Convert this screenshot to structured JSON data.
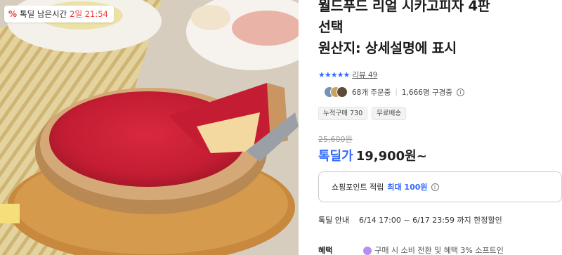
{
  "deal_timer": {
    "icon": "percent-icon",
    "label": "톡딜 남은시간",
    "time": "2일 21:54",
    "accent": "#f03c3c"
  },
  "product": {
    "title_lines": [
      "월드푸드 리얼 시카고피자 4판",
      "선택",
      "원산지: 상세설명에 표시"
    ],
    "stars": "★★★★★",
    "review_label": "리뷰 49",
    "order_count": "68개 주문중",
    "viewers": "1,666명 구경중",
    "tags": [
      "누적구매 730",
      "무료배송"
    ],
    "original_price": "25,600원",
    "deal_label": "톡딜가",
    "price": "19,900원~",
    "points": {
      "label": "쇼핑포인트 적립",
      "highlight": "최대 100원"
    },
    "deal_info": {
      "label": "톡딜 안내",
      "period": "6/14 17:00 ~ 6/17 23:59 까지 한정할인"
    },
    "benefit": {
      "label": "혜택",
      "text": "구매 시 소비 전환 및 혜택 3% 소프트인"
    }
  },
  "colors": {
    "accent_blue": "#346aff",
    "deal_red": "#f03c3c"
  }
}
